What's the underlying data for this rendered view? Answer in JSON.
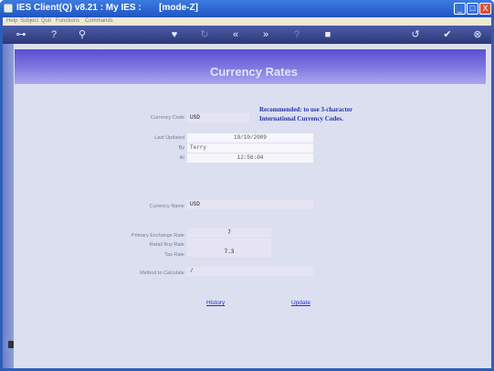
{
  "window": {
    "title": "IES Client(Q) v8.21 : My IES :       [mode-Z]",
    "min_label": "_",
    "max_label": "□",
    "close_label": "X"
  },
  "menu": {
    "items": [
      "Help",
      "Subject",
      "Quit",
      "Functions",
      "Commands"
    ]
  },
  "toolbar": {
    "icons": [
      "key-icon",
      "help-icon",
      "search-icon",
      "heart-icon",
      "refresh-icon",
      "rewind-icon",
      "fast-forward-icon",
      "help-dim-icon",
      "stop-icon",
      "undo-icon",
      "accept-icon",
      "cancel-icon"
    ],
    "glyphs": {
      "key": "⊶",
      "help": "?",
      "search": "⚲",
      "heart": "♥",
      "refresh": "↻",
      "rewind": "«",
      "ffwd": "»",
      "help2": "?",
      "stop": "■",
      "undo": "↺",
      "accept": "✔",
      "cancel": "⊗"
    }
  },
  "page": {
    "title": "Currency Rates",
    "note_line1": "Recommended: to use 3-character",
    "note_line2": "International Currency Codes.",
    "labels": {
      "currency_code": "Currency Code",
      "last_updated": "Last Updated",
      "by": "By",
      "at": "At",
      "currency_name": "Currency Name",
      "primary_rate": "Primary Exchange Rate",
      "retail_buy": "Retail Buy Rate",
      "tax_rate": "Tax Rate",
      "method": "Method to Calculate"
    },
    "values": {
      "currency_code": "USD",
      "last_updated": "19/10/2009",
      "by": "Terry",
      "at": "12:56:04",
      "currency_name": "USD",
      "primary_rate": "7",
      "retail_buy": "",
      "tax_rate": "7.3",
      "method": "/"
    },
    "links": {
      "history": "History",
      "update": "Update"
    }
  }
}
